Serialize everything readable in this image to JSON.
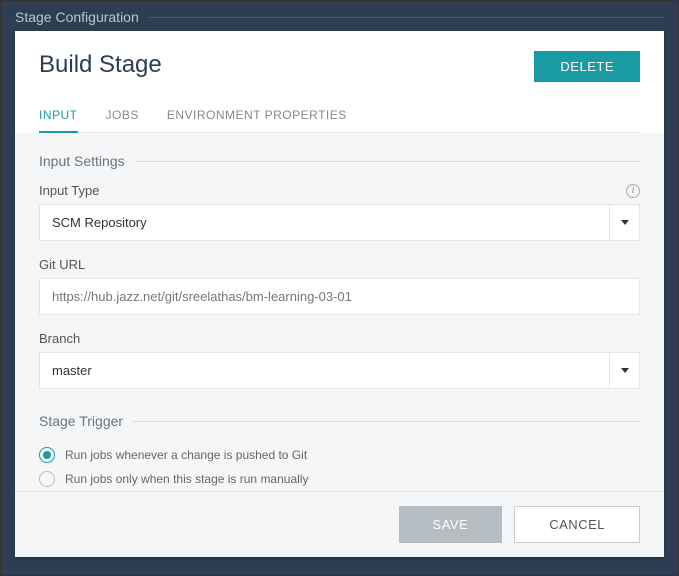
{
  "outer_title": "Stage Configuration",
  "header": {
    "title": "Build Stage",
    "delete_label": "DELETE"
  },
  "tabs": [
    {
      "label": "INPUT",
      "active": true
    },
    {
      "label": "JOBS",
      "active": false
    },
    {
      "label": "ENVIRONMENT PROPERTIES",
      "active": false
    }
  ],
  "input_settings": {
    "section_title": "Input Settings",
    "input_type": {
      "label": "Input Type",
      "value": "SCM Repository"
    },
    "git_url": {
      "label": "Git URL",
      "value": "https://hub.jazz.net/git/sreelathas/bm-learning-03-01"
    },
    "branch": {
      "label": "Branch",
      "value": "master"
    }
  },
  "stage_trigger": {
    "section_title": "Stage Trigger",
    "options": [
      {
        "label": "Run jobs whenever a change is pushed to Git",
        "selected": true
      },
      {
        "label": "Run jobs only when this stage is run manually",
        "selected": false
      }
    ]
  },
  "footer": {
    "save_label": "SAVE",
    "cancel_label": "CANCEL"
  }
}
